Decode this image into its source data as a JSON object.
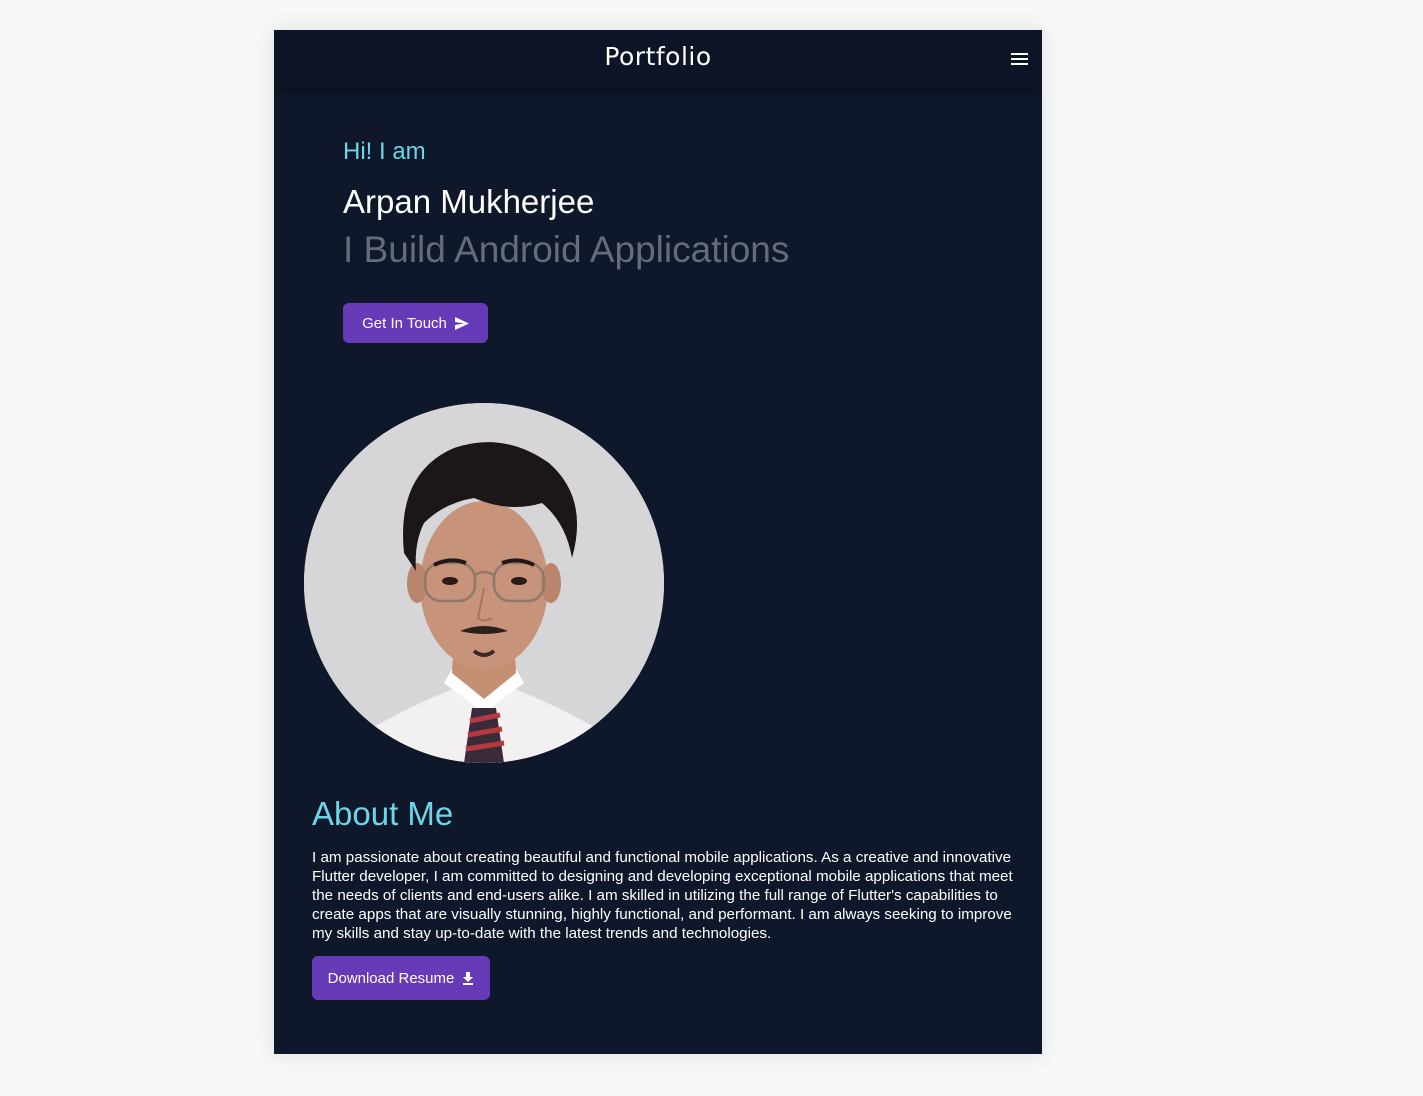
{
  "header": {
    "brand": "Portfolio",
    "menu_icon": "menu-icon"
  },
  "hero": {
    "greeting": "Hi! I am",
    "name": "Arpan Mukherjee",
    "tagline": "I Build Android Applications",
    "cta_label": "Get In Touch",
    "cta_icon": "send-icon"
  },
  "about": {
    "title": "About Me",
    "text": "I am passionate about creating beautiful and functional mobile applications. As a creative and innovative Flutter developer, I am committed to designing and developing exceptional mobile applications that meet the needs of clients and end-users alike. I am skilled in utilizing the full range of Flutter's capabilities to create apps that are visually stunning, highly functional, and performant. I am always seeking to improve my skills and stay up-to-date with the latest trends and technologies.",
    "resume_label": "Download Resume",
    "resume_icon": "download-icon"
  },
  "colors": {
    "background": "#0f172a",
    "accent": "#6cd6e8",
    "button": "#673ab7",
    "tagline": "#656c78"
  }
}
